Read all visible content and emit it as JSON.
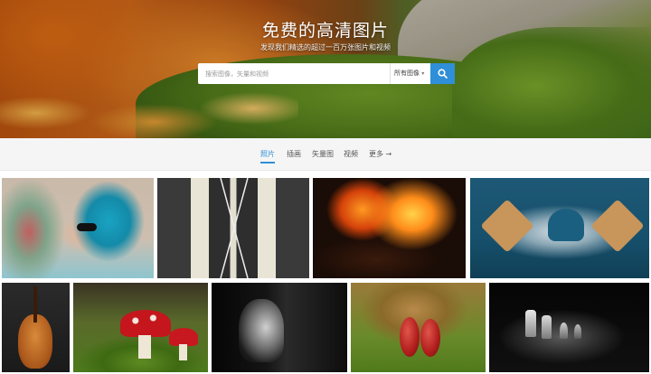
{
  "hero": {
    "title": "免费的高清图片",
    "subtitle": "发现我们精选的超过一百万张图片和视频"
  },
  "search": {
    "placeholder": "搜索图像，矢量和视频",
    "category_selected": "所有图像",
    "icon": "search-icon"
  },
  "tabs": [
    {
      "label": "照片",
      "active": true
    },
    {
      "label": "插画",
      "active": false
    },
    {
      "label": "矢量图",
      "active": false
    },
    {
      "label": "视频",
      "active": false
    },
    {
      "label": "更多 →",
      "active": false
    }
  ],
  "colors": {
    "accent": "#2f8fd8",
    "tab_bar_bg": "#f5f5f5"
  },
  "photos": [
    {
      "subject": "woman-blue-hair"
    },
    {
      "subject": "road-markings"
    },
    {
      "subject": "fire-embers"
    },
    {
      "subject": "heart-crackers"
    },
    {
      "subject": "violin"
    },
    {
      "subject": "red-mushrooms"
    },
    {
      "subject": "girl-portrait-bw"
    },
    {
      "subject": "chestnuts"
    },
    {
      "subject": "chess-pieces"
    }
  ]
}
